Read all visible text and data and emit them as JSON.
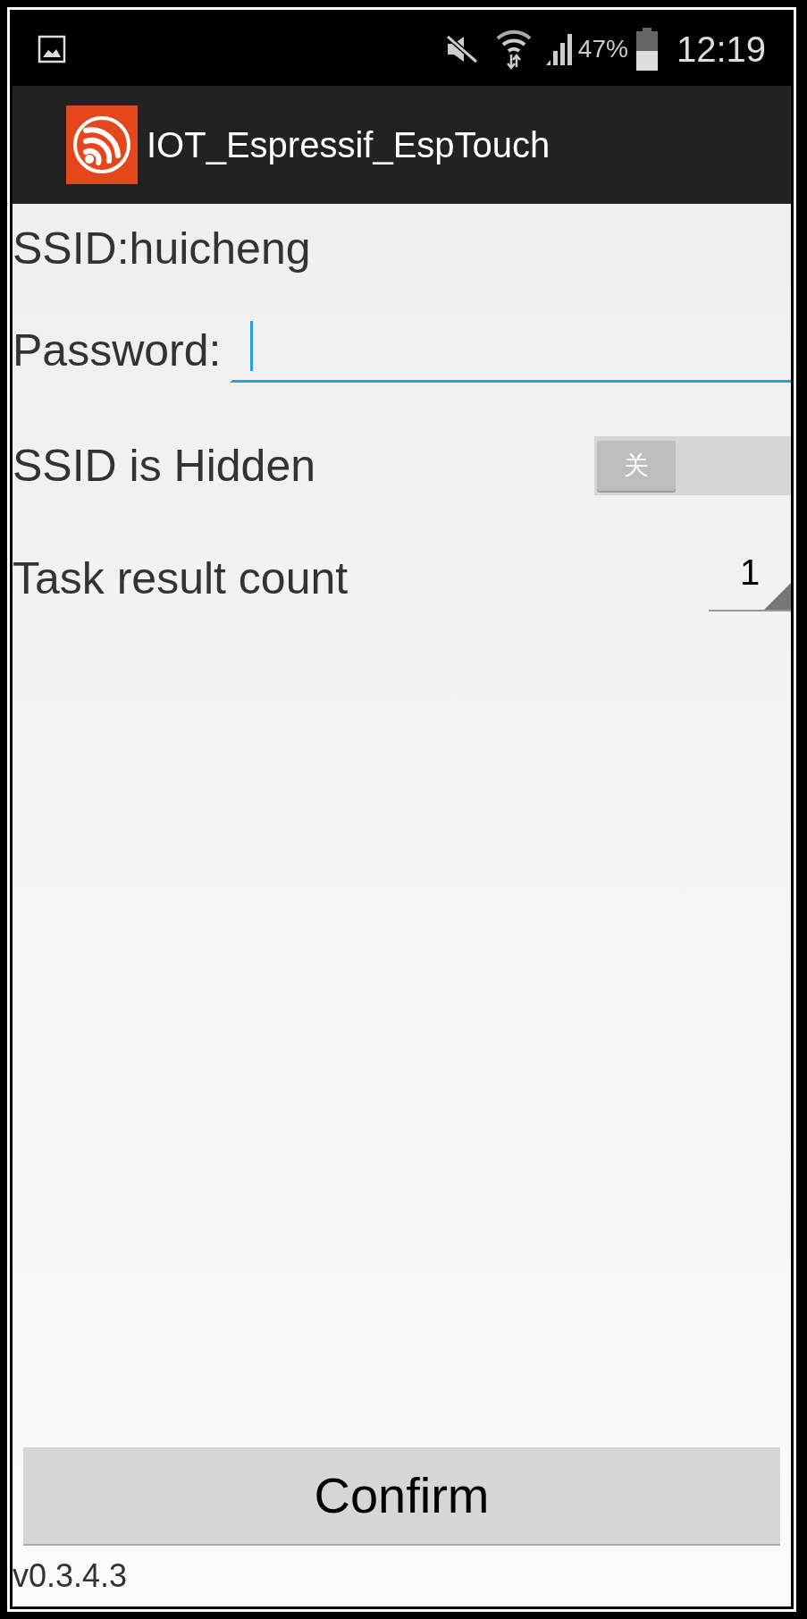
{
  "status_bar": {
    "battery": "47%",
    "time": "12:19"
  },
  "app_bar": {
    "title": "IOT_Espressif_EspTouch"
  },
  "ssid": {
    "text": "SSID:huicheng"
  },
  "password": {
    "label": "Password:",
    "focused": true
  },
  "hidden_switch": {
    "label": "SSID is Hidden",
    "on": false,
    "state_text": "关"
  },
  "task_count": {
    "label": "Task result count",
    "value": "1"
  },
  "confirm_button": {
    "label": "Confirm"
  },
  "version": "v0.3.4.3"
}
